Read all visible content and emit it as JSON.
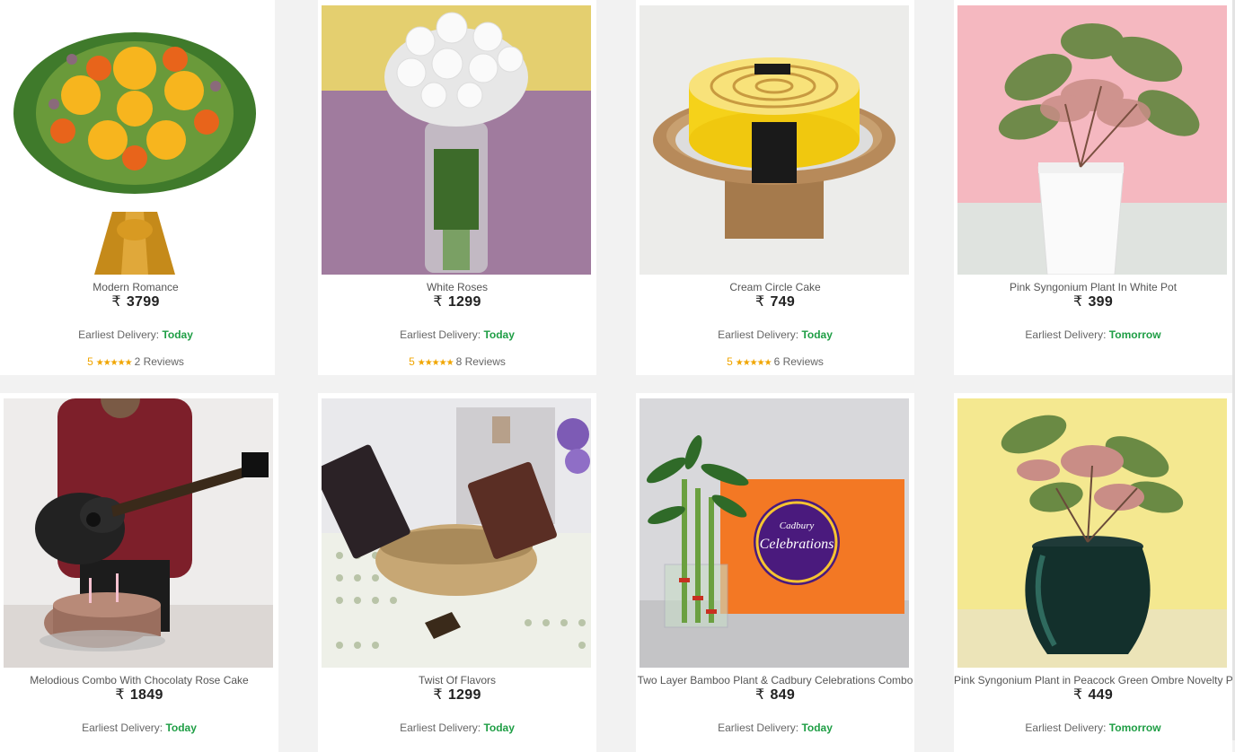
{
  "currency_symbol": "₹",
  "delivery_label": "Earliest Delivery:",
  "stars_glyph": "★★★★★",
  "products": [
    {
      "name": "Modern Romance",
      "price": "3799",
      "delivery": "Today",
      "rating": "5",
      "reviews": "2 Reviews",
      "image_icon": "flower-bouquet-image"
    },
    {
      "name": "White Roses",
      "price": "1299",
      "delivery": "Today",
      "rating": "5",
      "reviews": "8 Reviews",
      "image_icon": "white-roses-vase-image"
    },
    {
      "name": "Cream Circle Cake",
      "price": "749",
      "delivery": "Today",
      "rating": "5",
      "reviews": "6 Reviews",
      "image_icon": "cake-image"
    },
    {
      "name": "Pink Syngonium Plant In White Pot",
      "price": "399",
      "delivery": "Tomorrow",
      "image_icon": "plant-white-pot-image"
    },
    {
      "name": "Melodious Combo With Chocolaty Rose Cake",
      "price": "1849",
      "delivery": "Today",
      "image_icon": "guitar-cake-image"
    },
    {
      "name": "Twist Of Flavors",
      "price": "1299",
      "delivery": "Today",
      "image_icon": "chocolate-basket-image"
    },
    {
      "name": "Two Layer Bamboo Plant & Cadbury Celebrations Combo",
      "price": "849",
      "delivery": "Today",
      "image_icon": "bamboo-celebrations-image",
      "box_text": "Celebrations",
      "brand_text": "Cadbury"
    },
    {
      "name": "Pink Syngonium Plant in Peacock Green Ombre Novelty Pot",
      "price": "449",
      "delivery": "Tomorrow",
      "image_icon": "plant-green-pot-image"
    }
  ],
  "colors": {
    "accent_green": "#1f9e45",
    "star": "#f0a500"
  }
}
